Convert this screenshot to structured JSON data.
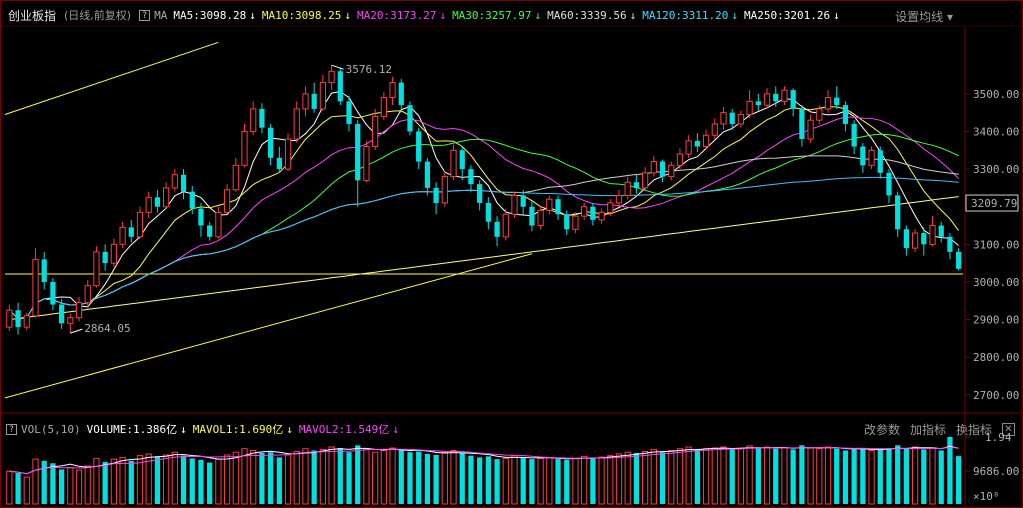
{
  "header": {
    "title": "创业板指",
    "subtitle": "(日线,前复权)",
    "help_icon": "?",
    "ma_tag": "MA",
    "settings": "设置均线",
    "mas": [
      {
        "label": "MA5:3098.28",
        "color": "#ffffff",
        "arrow": "↓"
      },
      {
        "label": "MA10:3098.25",
        "color": "#ffff40",
        "arrow": "↓"
      },
      {
        "label": "MA20:3173.27",
        "color": "#ff40ff",
        "arrow": "↓"
      },
      {
        "label": "MA30:3257.97",
        "color": "#40ff40",
        "arrow": "↓"
      },
      {
        "label": "MA60:3339.56",
        "color": "#e0e0e0",
        "arrow": "↓"
      },
      {
        "label": "MA120:3311.20",
        "color": "#40e0ff",
        "arrow": "↓"
      },
      {
        "label": "MA250:3201.26",
        "color": "#ffffff",
        "arrow": "↓"
      }
    ]
  },
  "volume_header": {
    "help_icon": "?",
    "label": "VOL(5,10)",
    "items": [
      {
        "label": "VOLUME:1.386亿",
        "color": "#ffffff",
        "arrow": "↓"
      },
      {
        "label": "MAVOL1:1.690亿",
        "color": "#ffff40",
        "arrow": "↓"
      },
      {
        "label": "MAVOL2:1.549亿",
        "color": "#ff40ff",
        "arrow": "↓"
      }
    ],
    "actions": [
      "改参数",
      "加指标",
      "换指标"
    ],
    "close": "✕"
  },
  "colors": {
    "up": "#ff3c3c",
    "down": "#00e0e0",
    "ma5": "#ffffff",
    "ma10": "#ffff40",
    "ma20": "#ff40ff",
    "ma30": "#40ff40",
    "ma60": "#d0d0d0",
    "ma120": "#40c0ff",
    "ma250": "#ffff80"
  },
  "chart_data": {
    "type": "candlestick",
    "price_axis": {
      "ticks": [
        3500,
        3400,
        3300,
        3200,
        3100,
        3000,
        2900,
        2800,
        2700
      ],
      "ylim": [
        2665,
        3675
      ],
      "current_price": 3209.79,
      "current_price_label": "3209.79"
    },
    "annotations": [
      {
        "label": "3576.12",
        "value": 3576.12
      },
      {
        "label": "2864.05",
        "value": 2864.05
      }
    ],
    "horizontal_line": 3021,
    "volume_axis": {
      "ticks": [
        "1.94",
        "9686.00"
      ],
      "max_value": 1.94,
      "unit_label": "×10⁸"
    },
    "candles": [
      [
        2880,
        2925,
        2870,
        2940
      ],
      [
        2925,
        2880,
        2860,
        2945
      ],
      [
        2880,
        2910,
        2872,
        2918
      ],
      [
        2910,
        3060,
        2905,
        3090
      ],
      [
        3060,
        3000,
        2980,
        3080
      ],
      [
        3000,
        2940,
        2925,
        3010
      ],
      [
        2940,
        2890,
        2875,
        2955
      ],
      [
        2890,
        2905,
        2864,
        2915
      ],
      [
        2905,
        2945,
        2895,
        2960
      ],
      [
        2945,
        2990,
        2930,
        3005
      ],
      [
        2990,
        3080,
        2985,
        3095
      ],
      [
        3080,
        3050,
        3030,
        3100
      ],
      [
        3050,
        3100,
        3040,
        3115
      ],
      [
        3100,
        3145,
        3090,
        3160
      ],
      [
        3145,
        3120,
        3105,
        3165
      ],
      [
        3120,
        3185,
        3115,
        3200
      ],
      [
        3185,
        3225,
        3170,
        3240
      ],
      [
        3225,
        3200,
        3185,
        3245
      ],
      [
        3200,
        3250,
        3195,
        3265
      ],
      [
        3250,
        3285,
        3240,
        3300
      ],
      [
        3285,
        3240,
        3220,
        3300
      ],
      [
        3240,
        3195,
        3180,
        3255
      ],
      [
        3195,
        3150,
        3120,
        3210
      ],
      [
        3150,
        3120,
        3110,
        3160
      ],
      [
        3120,
        3185,
        3115,
        3200
      ],
      [
        3185,
        3245,
        3180,
        3260
      ],
      [
        3245,
        3310,
        3240,
        3330
      ],
      [
        3310,
        3400,
        3305,
        3420
      ],
      [
        3400,
        3460,
        3390,
        3480
      ],
      [
        3460,
        3410,
        3395,
        3475
      ],
      [
        3410,
        3330,
        3310,
        3420
      ],
      [
        3330,
        3300,
        3290,
        3360
      ],
      [
        3300,
        3380,
        3295,
        3395
      ],
      [
        3380,
        3460,
        3370,
        3480
      ],
      [
        3460,
        3500,
        3440,
        3520
      ],
      [
        3500,
        3460,
        3450,
        3530
      ],
      [
        3460,
        3530,
        3455,
        3550
      ],
      [
        3530,
        3560,
        3510,
        3576
      ],
      [
        3560,
        3480,
        3470,
        3570
      ],
      [
        3480,
        3420,
        3400,
        3495
      ],
      [
        3420,
        3270,
        3200,
        3430
      ],
      [
        3270,
        3360,
        3265,
        3375
      ],
      [
        3360,
        3440,
        3350,
        3460
      ],
      [
        3440,
        3490,
        3430,
        3505
      ],
      [
        3490,
        3530,
        3470,
        3545
      ],
      [
        3530,
        3470,
        3450,
        3540
      ],
      [
        3470,
        3400,
        3390,
        3480
      ],
      [
        3400,
        3320,
        3300,
        3410
      ],
      [
        3320,
        3250,
        3230,
        3330
      ],
      [
        3250,
        3210,
        3180,
        3265
      ],
      [
        3210,
        3280,
        3200,
        3295
      ],
      [
        3280,
        3350,
        3270,
        3365
      ],
      [
        3350,
        3300,
        3270,
        3360
      ],
      [
        3300,
        3260,
        3240,
        3310
      ],
      [
        3260,
        3210,
        3190,
        3270
      ],
      [
        3210,
        3160,
        3140,
        3225
      ],
      [
        3160,
        3120,
        3095,
        3175
      ],
      [
        3120,
        3180,
        3110,
        3195
      ],
      [
        3180,
        3230,
        3170,
        3240
      ],
      [
        3230,
        3200,
        3180,
        3245
      ],
      [
        3200,
        3150,
        3135,
        3215
      ],
      [
        3150,
        3190,
        3140,
        3200
      ],
      [
        3190,
        3220,
        3180,
        3230
      ],
      [
        3220,
        3180,
        3165,
        3230
      ],
      [
        3180,
        3140,
        3125,
        3190
      ],
      [
        3140,
        3175,
        3130,
        3185
      ],
      [
        3175,
        3200,
        3165,
        3210
      ],
      [
        3200,
        3165,
        3150,
        3210
      ],
      [
        3165,
        3185,
        3155,
        3195
      ],
      [
        3185,
        3210,
        3175,
        3220
      ],
      [
        3210,
        3230,
        3200,
        3245
      ],
      [
        3230,
        3265,
        3220,
        3280
      ],
      [
        3265,
        3250,
        3235,
        3285
      ],
      [
        3250,
        3290,
        3240,
        3305
      ],
      [
        3290,
        3320,
        3280,
        3335
      ],
      [
        3320,
        3280,
        3265,
        3325
      ],
      [
        3280,
        3310,
        3270,
        3320
      ],
      [
        3310,
        3340,
        3300,
        3355
      ],
      [
        3340,
        3375,
        3330,
        3390
      ],
      [
        3375,
        3360,
        3345,
        3395
      ],
      [
        3360,
        3390,
        3350,
        3405
      ],
      [
        3390,
        3420,
        3380,
        3435
      ],
      [
        3420,
        3450,
        3405,
        3465
      ],
      [
        3450,
        3420,
        3405,
        3460
      ],
      [
        3420,
        3445,
        3410,
        3455
      ],
      [
        3445,
        3480,
        3435,
        3510
      ],
      [
        3480,
        3470,
        3455,
        3500
      ],
      [
        3470,
        3500,
        3460,
        3515
      ],
      [
        3500,
        3480,
        3465,
        3520
      ],
      [
        3480,
        3510,
        3470,
        3520
      ],
      [
        3510,
        3460,
        3440,
        3515
      ],
      [
        3460,
        3380,
        3360,
        3470
      ],
      [
        3380,
        3430,
        3370,
        3445
      ],
      [
        3430,
        3460,
        3420,
        3470
      ],
      [
        3460,
        3490,
        3450,
        3510
      ],
      [
        3490,
        3470,
        3460,
        3520
      ],
      [
        3470,
        3420,
        3400,
        3480
      ],
      [
        3420,
        3360,
        3340,
        3430
      ],
      [
        3360,
        3310,
        3290,
        3370
      ],
      [
        3310,
        3350,
        3300,
        3360
      ],
      [
        3350,
        3290,
        3275,
        3360
      ],
      [
        3290,
        3230,
        3210,
        3300
      ],
      [
        3230,
        3140,
        3120,
        3240
      ],
      [
        3140,
        3090,
        3070,
        3150
      ],
      [
        3090,
        3130,
        3080,
        3140
      ],
      [
        3130,
        3100,
        3070,
        3145
      ],
      [
        3100,
        3150,
        3095,
        3175
      ],
      [
        3150,
        3120,
        3105,
        3160
      ],
      [
        3120,
        3080,
        3060,
        3130
      ],
      [
        3080,
        3035,
        3030,
        3090
      ]
    ],
    "volumes": [
      0.95,
      0.9,
      0.78,
      1.3,
      1.25,
      1.18,
      1.0,
      1.05,
      0.98,
      1.1,
      1.32,
      1.22,
      1.3,
      1.35,
      1.25,
      1.4,
      1.45,
      1.38,
      1.42,
      1.5,
      1.4,
      1.32,
      1.28,
      1.2,
      1.3,
      1.42,
      1.5,
      1.6,
      1.55,
      1.48,
      1.5,
      1.35,
      1.42,
      1.52,
      1.6,
      1.55,
      1.58,
      1.65,
      1.62,
      1.5,
      1.7,
      1.58,
      1.5,
      1.55,
      1.62,
      1.58,
      1.5,
      1.52,
      1.45,
      1.42,
      1.5,
      1.55,
      1.48,
      1.4,
      1.35,
      1.38,
      1.3,
      1.32,
      1.4,
      1.35,
      1.3,
      1.32,
      1.35,
      1.3,
      1.28,
      1.32,
      1.38,
      1.34,
      1.36,
      1.4,
      1.45,
      1.5,
      1.48,
      1.52,
      1.58,
      1.5,
      1.55,
      1.6,
      1.65,
      1.58,
      1.6,
      1.62,
      1.65,
      1.58,
      1.62,
      1.68,
      1.62,
      1.65,
      1.6,
      1.63,
      1.58,
      1.7,
      1.62,
      1.6,
      1.65,
      1.6,
      1.55,
      1.58,
      1.62,
      1.55,
      1.58,
      1.62,
      1.7,
      1.6,
      1.65,
      1.58,
      1.62,
      1.55,
      1.94,
      1.386
    ]
  }
}
